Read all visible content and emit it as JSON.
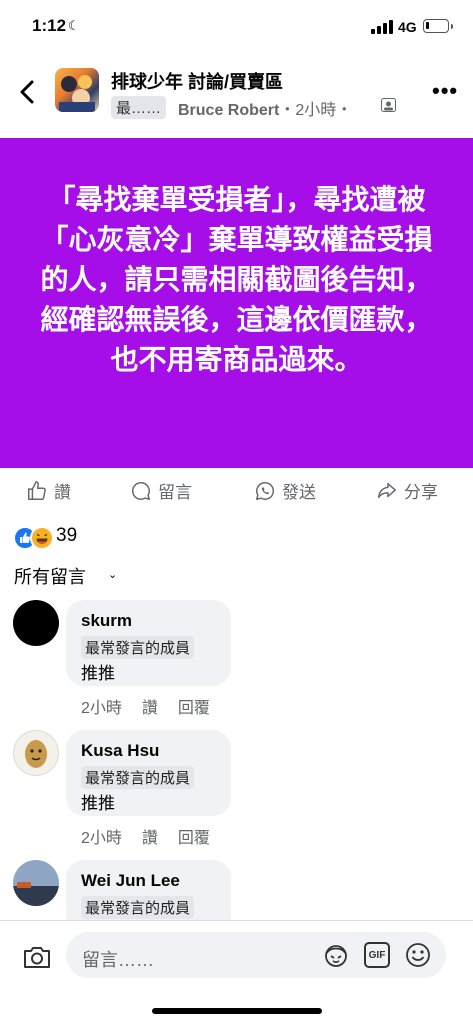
{
  "status_bar": {
    "time": "1:12",
    "network": "4G",
    "battery_percent": 15
  },
  "header": {
    "group_title": "排球少年 討論/買賣區",
    "badge": "最……",
    "author": "Bruce Robert",
    "time": "・2小時・"
  },
  "post": {
    "text": "「尋找棄單受損者」，尋找遭被「心灰意冷」棄單導致權益受損的人，請只需相關截圖後告知，經確認無誤後，這邊依價匯款，也不用寄商品過來。",
    "background": "#a50ee8"
  },
  "actions": {
    "like": "讚",
    "comment": "留言",
    "send": "發送",
    "share": "分享"
  },
  "reactions": {
    "count": "39"
  },
  "comments_header": "所有留言",
  "comments": [
    {
      "name": "skurm",
      "role": "最常發言的成員",
      "text": "推推",
      "time": "2小時",
      "like": "讚",
      "reply": "回覆"
    },
    {
      "name": "Kusa Hsu",
      "role": "最常發言的成員",
      "text": "推推",
      "time": "2小時",
      "like": "讚",
      "reply": "回覆"
    },
    {
      "name": "Wei Jun Lee",
      "role": "最常發言的成員"
    }
  ],
  "composer": {
    "placeholder": "留言……",
    "gif": "GIF"
  }
}
